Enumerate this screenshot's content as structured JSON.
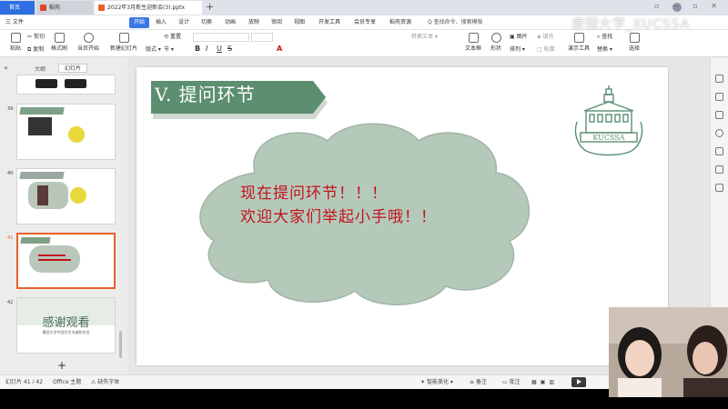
{
  "tabs": {
    "home": "首页",
    "shell": "稻壳",
    "document": "2022年3月新生迎新会(3).pptx",
    "add": "+"
  },
  "watermark_name": "康园大学_KUCSSA",
  "menu": {
    "file": "三 文件",
    "items": [
      "开始",
      "插入",
      "设计",
      "切换",
      "动画",
      "放映",
      "审阅",
      "视图",
      "开发工具",
      "会员专享",
      "稻壳资源"
    ],
    "search": "Q 查找命令、搜索模板"
  },
  "ribbon": {
    "paste": "粘贴",
    "cut": "剪切",
    "copy": "复制",
    "format_painter": "格式刷",
    "from_start": "当页开始",
    "new_slide": "新建幻灯片",
    "layout": "版式",
    "section": "节",
    "reset": "重置",
    "bold": "B",
    "italic": "I",
    "underline": "U",
    "strike": "S",
    "font_color": "A",
    "convert_text": "转换文本",
    "text_box": "文本框",
    "shape": "形状",
    "arrange": "排列",
    "picture": "图片",
    "fill": "填充",
    "outline": "轮廓",
    "find": "查找",
    "replace": "替换",
    "presentation_tools": "演示工具",
    "select": "选择"
  },
  "left_panel": {
    "outline_tab": "大纲",
    "slides_tab": "幻灯片",
    "slide_numbers": [
      "39",
      "40",
      "41",
      "42"
    ],
    "thumb_42_title": "感谢观看",
    "thumb_42_sub": "康园大学中国学生学者联合会",
    "add": "+"
  },
  "slide": {
    "title": "V. 提问环节",
    "line1": "现在提问环节！！！",
    "line2": "欢迎大家们举起小手哦！！",
    "logo_text": "KUCSSA"
  },
  "status": {
    "slide_count": "幻灯片 41 / 42",
    "theme": "Office 主题",
    "missing_font": "缺失字体",
    "beautify": "智能美化",
    "notes": "备注",
    "comments": "批注"
  },
  "colors": {
    "accent_blue": "#3b78e7",
    "banner_green": "#5b8f70",
    "cloud_fill": "#b5c9bb",
    "text_red": "#c0141c",
    "thumb_selected": "#e8602c"
  }
}
